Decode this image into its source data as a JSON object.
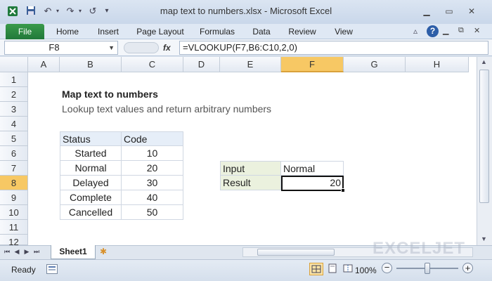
{
  "app": {
    "title": "map text to numbers.xlsx - Microsoft Excel"
  },
  "ribbon": {
    "file_tab": "File",
    "tabs": [
      "Home",
      "Insert",
      "Page Layout",
      "Formulas",
      "Data",
      "Review",
      "View"
    ]
  },
  "formula_bar": {
    "name_box": "F8",
    "fx": "fx",
    "formula": "=VLOOKUP(F7,B6:C10,2,0)"
  },
  "columns": [
    "A",
    "B",
    "C",
    "D",
    "E",
    "F",
    "G",
    "H"
  ],
  "rows": [
    "1",
    "2",
    "3",
    "4",
    "5",
    "6",
    "7",
    "8",
    "9",
    "10",
    "11",
    "12"
  ],
  "sheet": {
    "title": "Map text to numbers",
    "subtitle": "Lookup text values and return arbitrary numbers",
    "table_headers": [
      "Status",
      "Code"
    ],
    "table_rows": [
      [
        "Started",
        "10"
      ],
      [
        "Normal",
        "20"
      ],
      [
        "Delayed",
        "30"
      ],
      [
        "Complete",
        "40"
      ],
      [
        "Cancelled",
        "50"
      ]
    ],
    "input_label": "Input",
    "input_value": "Normal",
    "result_label": "Result",
    "result_value": "20"
  },
  "sheet_tabs": [
    "Sheet1"
  ],
  "status_bar": {
    "ready": "Ready",
    "zoom": "100%"
  },
  "watermark": "EXCELJET"
}
